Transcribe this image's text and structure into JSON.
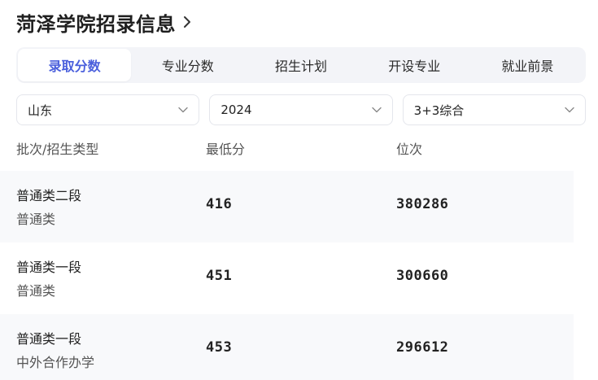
{
  "header": {
    "title": "菏泽学院招录信息"
  },
  "tabs": [
    {
      "label": "录取分数",
      "active": true
    },
    {
      "label": "专业分数",
      "active": false
    },
    {
      "label": "招生计划",
      "active": false
    },
    {
      "label": "开设专业",
      "active": false
    },
    {
      "label": "就业前景",
      "active": false
    }
  ],
  "filters": {
    "province": "山东",
    "year": "2024",
    "subject": "3+3综合"
  },
  "table": {
    "headers": [
      "批次/招生类型",
      "最低分",
      "位次"
    ],
    "rows": [
      {
        "batch": "普通类二段",
        "type": "普通类",
        "min_score": "416",
        "rank": "380286"
      },
      {
        "batch": "普通类一段",
        "type": "普通类",
        "min_score": "451",
        "rank": "300660"
      },
      {
        "batch": "普通类一段",
        "type": "中外合作办学",
        "min_score": "453",
        "rank": "296612"
      }
    ]
  },
  "colors": {
    "accent": "#4a5fdc",
    "tab_bg": "#f3f4f8",
    "row_shade": "#f8f9fb"
  },
  "icons": {
    "header_chevron": "chevron-right-icon",
    "select_arrow": "chevron-down-icon"
  }
}
